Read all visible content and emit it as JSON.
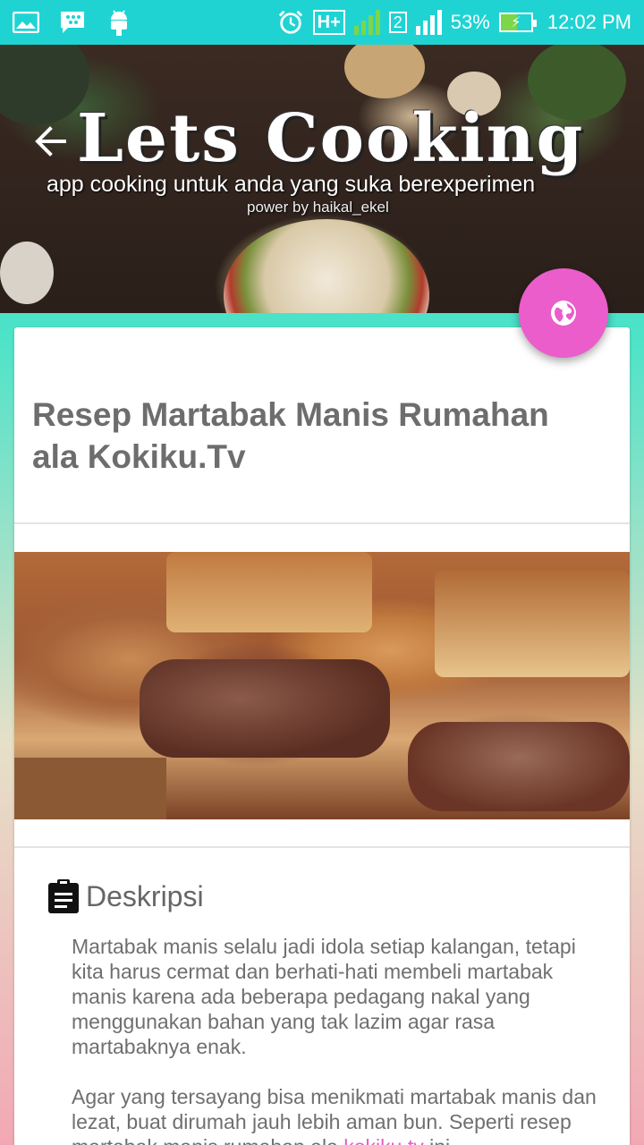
{
  "status_bar": {
    "battery_percent": "53%",
    "time": "12:02 PM",
    "network_type": "H+",
    "sim2_label": "2",
    "icons": [
      "gallery-icon",
      "bbm-icon",
      "android-icon",
      "alarm-icon",
      "signal-icon",
      "battery-icon"
    ]
  },
  "header": {
    "app_title": "Lets Cooking",
    "tagline": "app cooking untuk anda yang suka berexperimen",
    "powered_by": "power by haikal_ekel"
  },
  "recipe": {
    "title": "Resep Martabak Manis Rumahan ala Kokiku.Tv"
  },
  "description": {
    "label": "Deskripsi",
    "paragraph1": "Martabak manis selalu jadi idola setiap kalangan, tetapi kita harus cermat dan berhati-hati membeli martabak manis karena ada beberapa pedagang nakal yang menggunakan bahan yang tak lazim agar rasa martabaknya enak.",
    "paragraph2_before_link": " Agar yang tersayang bisa menikmati martabak manis dan lezat, buat dirumah jauh lebih aman bun. Seperti resep martabak manis rumahan ala ",
    "link_text": "kokiku.tv",
    "paragraph2_after_link": " ini"
  },
  "colors": {
    "status_bar": "#1fd3d3",
    "fab": "#ea5dcb",
    "link": "#e65dc8",
    "title_text": "#6d6d6d"
  }
}
